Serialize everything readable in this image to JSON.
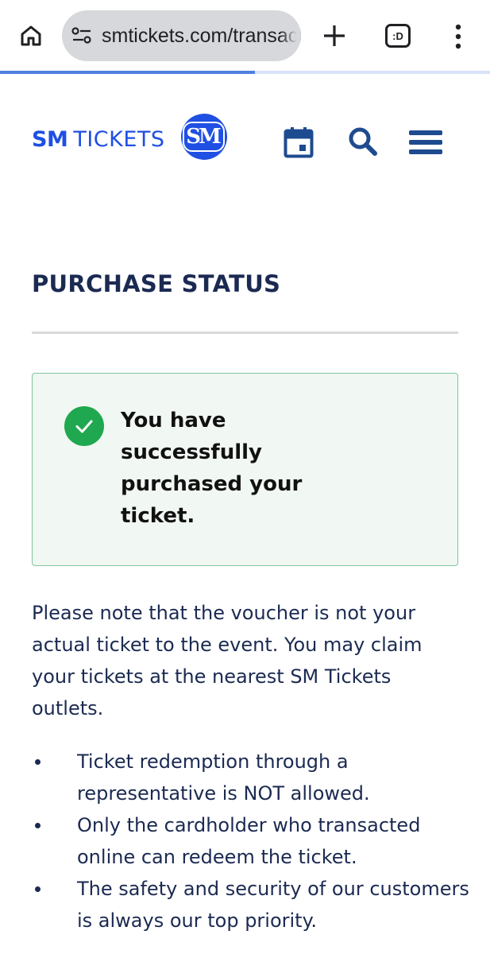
{
  "browser": {
    "url": "smtickets.com/transaction",
    "tabs_count": ":D",
    "load_progress": 0.52
  },
  "header": {
    "brand_sm": "SM",
    "brand_tickets": "TICKETS",
    "logo_text": "SM"
  },
  "main": {
    "title": "PURCHASE STATUS",
    "success_message": "You have successfully purchased your ticket.",
    "notice": "Please note that the voucher is not your actual ticket to the event. You may claim your tickets at the nearest SM Tickets outlets.",
    "policies": [
      "Ticket redemption through a representative is NOT allowed.",
      "Only the cardholder who transacted online can redeem the ticket.",
      "The safety and security of our customers is always our top priority."
    ]
  },
  "colors": {
    "brand_blue": "#1f4fe3",
    "navy": "#1b2a52",
    "success_green": "#1fa84f",
    "success_bg": "#f1f7f2",
    "success_border": "#7fc79e"
  },
  "icons": {
    "home": "home-icon",
    "site_settings": "site-settings-icon",
    "new_tab": "plus-icon",
    "tabs": "tab-switcher-icon",
    "more": "kebab-menu-icon",
    "calendar": "calendar-icon",
    "search": "search-icon",
    "menu": "hamburger-menu-icon",
    "success": "check-circle-icon"
  }
}
